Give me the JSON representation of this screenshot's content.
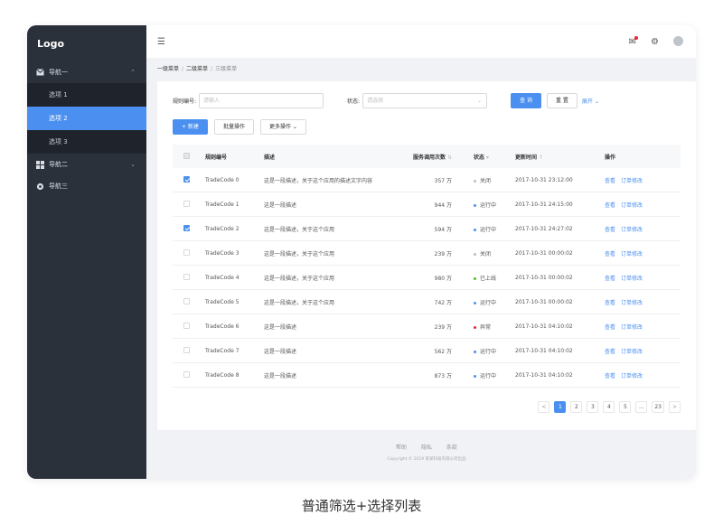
{
  "sidebar": {
    "logo": "Logo",
    "groups": [
      {
        "label": "导航一",
        "icon": "mail-icon",
        "expanded": true
      },
      {
        "label": "导航二",
        "icon": "grid-icon",
        "expanded": false
      },
      {
        "label": "导航三",
        "icon": "gear-icon",
        "expanded": false
      }
    ],
    "sub_items": [
      {
        "label": "选项 1",
        "active": false
      },
      {
        "label": "选项 2",
        "active": true
      },
      {
        "label": "选项 3",
        "active": false
      }
    ]
  },
  "header": {
    "menu_toggle_icon": "menu-fold-icon",
    "message_icon": "mail-icon",
    "settings_icon": "gear-icon",
    "avatar_icon": "avatar-icon"
  },
  "breadcrumb": [
    "一级菜单",
    "二级菜单",
    "三级菜单"
  ],
  "filters": {
    "rule_label": "规则编号:",
    "rule_placeholder": "请输入",
    "status_label": "状态:",
    "status_placeholder": "请选择",
    "query_label": "查 询",
    "reset_label": "重 置",
    "expand_label": "展开"
  },
  "actions": {
    "new_label": "+ 新建",
    "batch_label": "批量操作",
    "more_label": "更多操作"
  },
  "table": {
    "columns": [
      "规则编号",
      "描述",
      "服务调用次数",
      "状态",
      "更新时间",
      "操作"
    ],
    "rows": [
      {
        "checked": true,
        "code": "TradeCode 0",
        "desc": "这是一段描述，关于这个应用的描述文字内容",
        "count": "357 万",
        "status": "关闭",
        "status_color": "#bfbfbf",
        "time": "2017-10-31  23:12:00"
      },
      {
        "checked": false,
        "code": "TradeCode 1",
        "desc": "这是一段描述",
        "count": "944 万",
        "status": "运行中",
        "status_color": "#4b8ff0",
        "time": "2017-10-31  24:15:00"
      },
      {
        "checked": true,
        "code": "TradeCode 2",
        "desc": "这是一段描述，关于这个应用",
        "count": "594 万",
        "status": "运行中",
        "status_color": "#4b8ff0",
        "time": "2017-10-31  24:27:02"
      },
      {
        "checked": false,
        "code": "TradeCode 3",
        "desc": "这是一段描述，关于这个应用",
        "count": "239 万",
        "status": "关闭",
        "status_color": "#bfbfbf",
        "time": "2017-10-31  00:00:02"
      },
      {
        "checked": false,
        "code": "TradeCode 4",
        "desc": "这是一段描述，关于这个应用",
        "count": "980 万",
        "status": "已上线",
        "status_color": "#52c41a",
        "time": "2017-10-31  00:00:02"
      },
      {
        "checked": false,
        "code": "TradeCode 5",
        "desc": "这是一段描述，关于这个应用",
        "count": "742 万",
        "status": "运行中",
        "status_color": "#4b8ff0",
        "time": "2017-10-31  00:00:02"
      },
      {
        "checked": false,
        "code": "TradeCode 6",
        "desc": "这是一段描述",
        "count": "239 万",
        "status": "异常",
        "status_color": "#f5222d",
        "time": "2017-10-31  04:10:02"
      },
      {
        "checked": false,
        "code": "TradeCode 7",
        "desc": "这是一段描述",
        "count": "562 万",
        "status": "运行中",
        "status_color": "#4b8ff0",
        "time": "2017-10-31  04:10:02"
      },
      {
        "checked": false,
        "code": "TradeCode 8",
        "desc": "这是一段描述",
        "count": "873 万",
        "status": "运行中",
        "status_color": "#4b8ff0",
        "time": "2017-10-31  04:10:02"
      }
    ],
    "op_view": "查看",
    "op_edit": "订单修改"
  },
  "pagination": {
    "prev": "<",
    "pages": [
      "1",
      "2",
      "3",
      "4",
      "5",
      "...",
      "23"
    ],
    "active": "1",
    "next": ">"
  },
  "footer": {
    "links": [
      "帮助",
      "隐私",
      "条款"
    ],
    "copyright": "Copyright © 2019 某某科技有限公司出品"
  },
  "caption": "普通筛选+选择列表"
}
